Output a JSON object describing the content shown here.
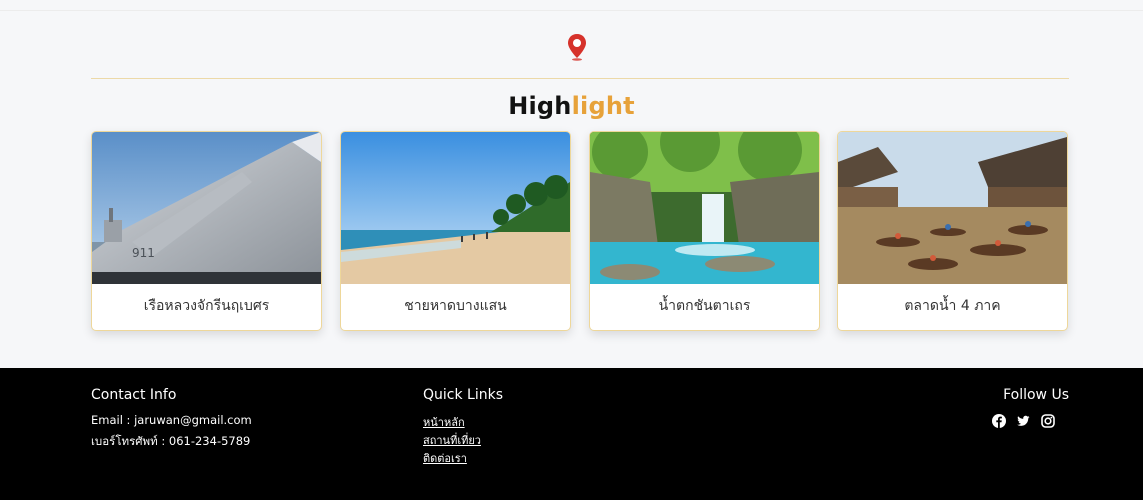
{
  "section": {
    "icon": "map-pin-icon",
    "title_part1": "High",
    "title_part2": "light",
    "accent_color": "#e7a23a",
    "pin_color": "#d6322b"
  },
  "cards": [
    {
      "label": "เรือหลวงจักรีนฤเบศร",
      "image": "aircraft-carrier-photo"
    },
    {
      "label": "ชายหาดบางแสน",
      "image": "beach-photo"
    },
    {
      "label": "น้ำตกชันตาเถร",
      "image": "waterfall-photo"
    },
    {
      "label": "ตลาดน้ำ 4 ภาค",
      "image": "floating-market-photo"
    }
  ],
  "footer": {
    "contact": {
      "title": "Contact Info",
      "email": "Email : jaruwan@gmail.com",
      "phone": "เบอร์โทรศัพท์ : 061-234-5789"
    },
    "quick_links": {
      "title": "Quick Links",
      "items": [
        "หน้าหลัก",
        "สถานที่เที่ยว",
        "ติดต่อเรา"
      ]
    },
    "follow": {
      "title": "Follow Us",
      "icons": [
        "facebook-icon",
        "twitter-icon",
        "instagram-icon"
      ]
    }
  }
}
